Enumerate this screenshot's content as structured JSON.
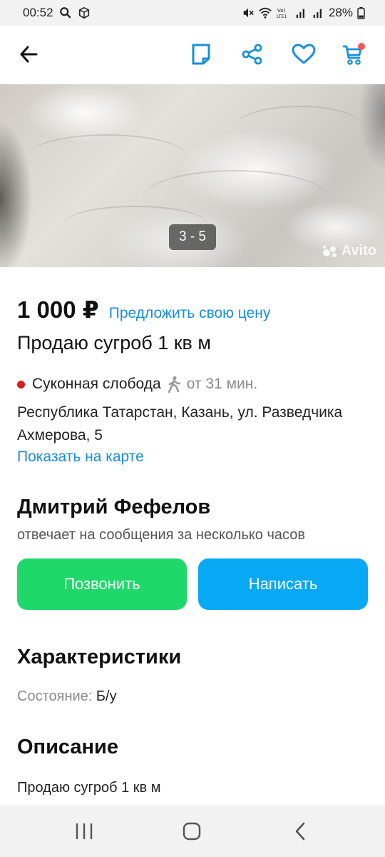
{
  "statusbar": {
    "time": "00:52",
    "battery": "28%"
  },
  "appbar": {
    "icons": [
      "back-arrow-icon",
      "note-icon",
      "share-icon",
      "heart-icon",
      "cart-icon"
    ],
    "accent": "#1a8fd8"
  },
  "gallery": {
    "counter": "3 - 5",
    "watermark": "Avito"
  },
  "listing": {
    "price": "1 000 ₽",
    "offer_link": "Предложить свою цену",
    "title": "Продаю сугроб 1 кв м",
    "metro_station": "Суконная слобода",
    "walk_time": "от 31 мин.",
    "address": "Республика Татарстан, Казань, ул. Разведчика Ахмерова, 5",
    "map_link": "Показать на карте"
  },
  "seller": {
    "name": "Дмитрий Фефелов",
    "response": "отвечает на сообщения за несколько часов"
  },
  "actions": {
    "call_label": "Позвонить",
    "write_label": "Написать",
    "call_color": "#1fd86a",
    "write_color": "#07a9f5"
  },
  "specs": {
    "heading": "Характеристики",
    "condition_key": "Состояние:",
    "condition_value": "Б/у"
  },
  "description": {
    "heading": "Описание",
    "text": "Продаю сугроб 1 кв м"
  },
  "navbar": {
    "icons": [
      "recent-apps-icon",
      "home-icon",
      "back-icon"
    ]
  }
}
